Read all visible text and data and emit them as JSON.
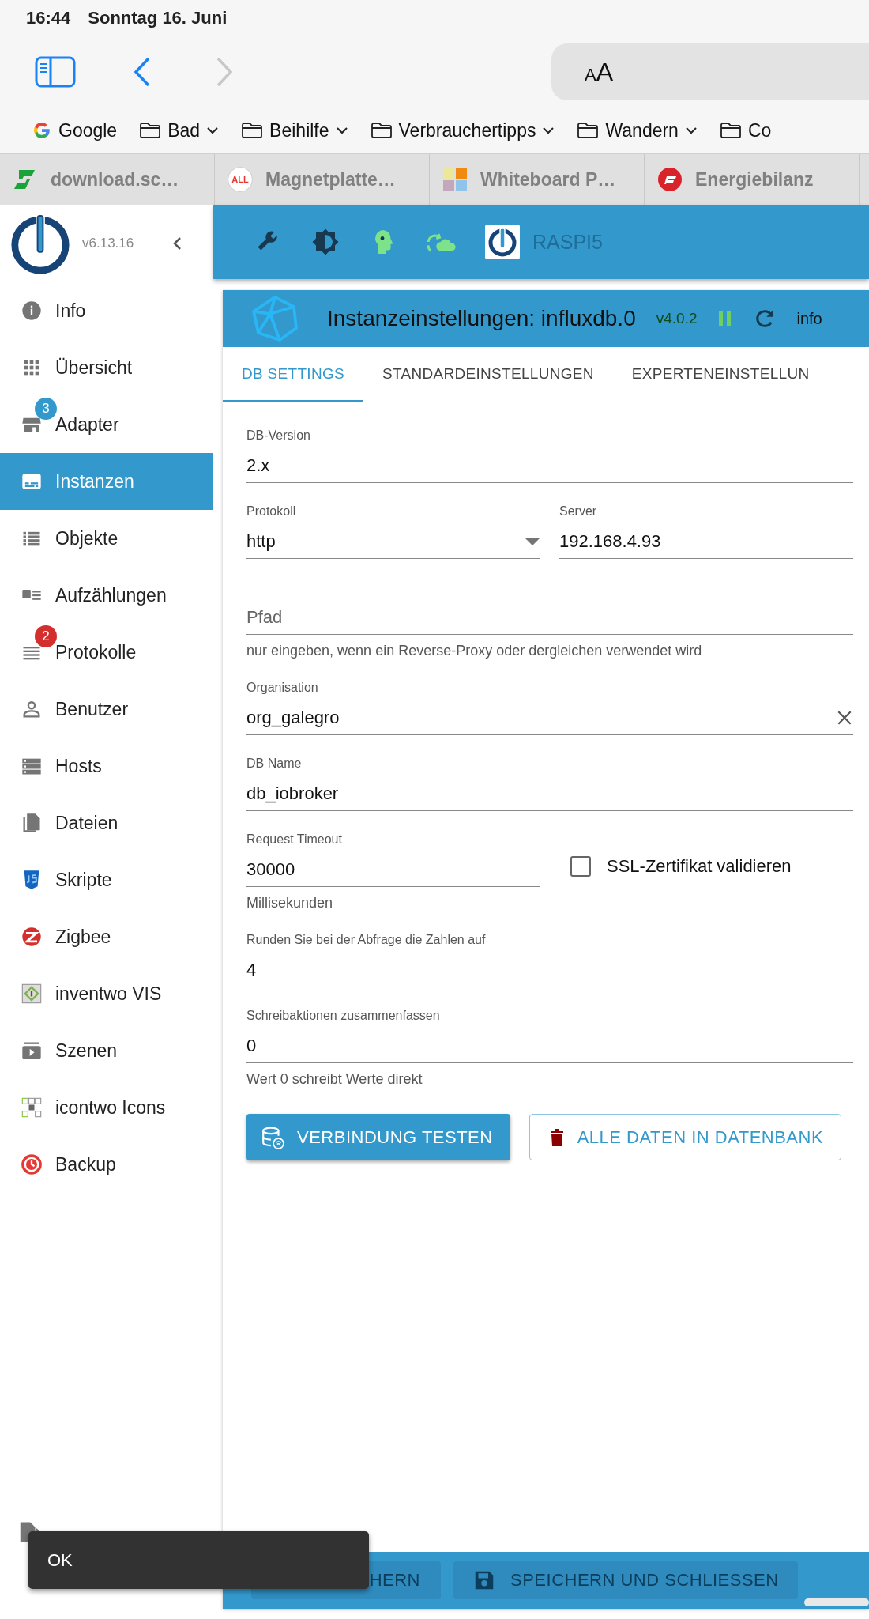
{
  "status_bar": {
    "time": "16:44",
    "date": "Sonntag 16. Juni"
  },
  "browser": {
    "address_field": {
      "text": "AA"
    },
    "bookmarks": [
      {
        "label": "Google",
        "kind": "site",
        "dropdown": false
      },
      {
        "label": "Bad",
        "kind": "folder",
        "dropdown": true
      },
      {
        "label": "Beihilfe",
        "kind": "folder",
        "dropdown": true
      },
      {
        "label": "Verbrauchertipps",
        "kind": "folder",
        "dropdown": true
      },
      {
        "label": "Wandern",
        "kind": "folder",
        "dropdown": true
      },
      {
        "label": "Co",
        "kind": "folder",
        "dropdown": false
      }
    ],
    "tabs": [
      {
        "title": "download.sc…"
      },
      {
        "title": "Magnetplatte…",
        "icon_text": "ALL"
      },
      {
        "title": "Whiteboard P…"
      },
      {
        "title": "Energiebilanz"
      }
    ]
  },
  "sidebar": {
    "version": "v6.13.16",
    "items": [
      {
        "label": "Info",
        "selected": false
      },
      {
        "label": "Übersicht",
        "selected": false
      },
      {
        "label": "Adapter",
        "selected": false,
        "badge": {
          "text": "3",
          "color": "#3399cc"
        }
      },
      {
        "label": "Instanzen",
        "selected": true
      },
      {
        "label": "Objekte",
        "selected": false
      },
      {
        "label": "Aufzählungen",
        "selected": false
      },
      {
        "label": "Protokolle",
        "selected": false,
        "badge": {
          "text": "2",
          "color": "#d32f2f"
        }
      },
      {
        "label": "Benutzer",
        "selected": false
      },
      {
        "label": "Hosts",
        "selected": false
      },
      {
        "label": "Dateien",
        "selected": false
      },
      {
        "label": "Skripte",
        "selected": false
      },
      {
        "label": "Zigbee",
        "selected": false
      },
      {
        "label": "inventwo VIS",
        "selected": false
      },
      {
        "label": "Szenen",
        "selected": false
      },
      {
        "label": "icontwo Icons",
        "selected": false
      },
      {
        "label": "Backup",
        "selected": false
      }
    ]
  },
  "app_toolbar": {
    "host": "RASPI5"
  },
  "instance": {
    "title": "Instanzeinstellungen: influxdb.0",
    "version": "v4.0.2",
    "info": "info",
    "tabs": [
      {
        "label": "DB SETTINGS",
        "selected": true
      },
      {
        "label": "STANDARDEINSTELLUNGEN",
        "selected": false
      },
      {
        "label": "EXPERTENEINSTELLUN",
        "selected": false
      }
    ],
    "rows": [
      {
        "fields": [
          {
            "kind": "text",
            "label": "DB-Version",
            "value": "2.x"
          }
        ]
      },
      {
        "fields": [
          {
            "kind": "select",
            "label": "Protokoll",
            "value": "http"
          },
          {
            "kind": "text",
            "label": "Server",
            "value": "192.168.4.93"
          }
        ]
      },
      {
        "fields": [
          {
            "kind": "text",
            "placeholder": "Pfad",
            "helper": "nur eingeben, wenn ein Reverse-Proxy oder dergleichen verwendet wird"
          }
        ]
      },
      {
        "fields": [
          {
            "kind": "text",
            "label": "Organisation",
            "value": "org_galegro",
            "clearable": true
          }
        ]
      },
      {
        "fields": [
          {
            "kind": "text",
            "label": "DB Name",
            "value": "db_iobroker"
          }
        ]
      },
      {
        "fields": [
          {
            "kind": "text",
            "label": "Request Timeout",
            "value": "30000",
            "helper": "Millisekunden"
          },
          {
            "kind": "checkbox",
            "label": "SSL-Zertifikat validieren",
            "checked": false
          }
        ]
      },
      {
        "fields": [
          {
            "kind": "text",
            "label": "Runden Sie bei der Abfrage die Zahlen auf",
            "value": "4"
          }
        ]
      },
      {
        "fields": [
          {
            "kind": "text",
            "label": "Schreibaktionen zusammenfassen",
            "value": "0",
            "helper": "Wert 0 schreibt Werte direkt"
          }
        ]
      }
    ],
    "buttons": [
      {
        "label": "VERBINDUNG TESTEN",
        "kind": "contained"
      },
      {
        "label": "ALLE DATEN IN DATENBANK",
        "kind": "outlined"
      }
    ],
    "footer_buttons": [
      {
        "label": "HERN",
        "disabled": true
      },
      {
        "label": "SPEICHERN UND SCHLIESSEN",
        "disabled": true
      }
    ]
  },
  "toast": {
    "message": "OK"
  }
}
